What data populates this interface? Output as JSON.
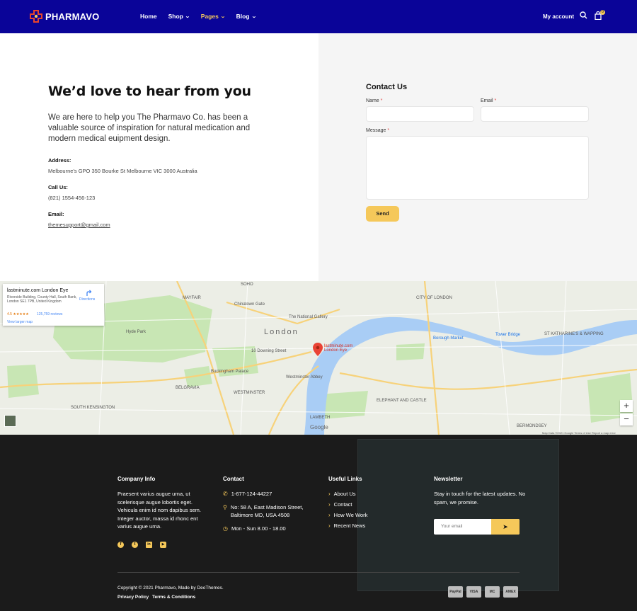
{
  "header": {
    "brand": "PHARMAVO",
    "nav": [
      {
        "label": "Home",
        "dropdown": false,
        "active": false
      },
      {
        "label": "Shop",
        "dropdown": true,
        "active": false
      },
      {
        "label": "Pages",
        "dropdown": true,
        "active": true
      },
      {
        "label": "Blog",
        "dropdown": true,
        "active": false
      }
    ],
    "account_label": "My account",
    "cart_count": "0",
    "icons": [
      "search-icon",
      "cart-icon"
    ],
    "colors": {
      "background": "#0a0498",
      "accent": "#f4c95d"
    }
  },
  "intro": {
    "heading": "We’d love to hear from you",
    "description": "We are here to help you The Pharmavo Co. has been a valuable source of inspiration for natural medication and modern medical euipment design.",
    "address_label": "Address:",
    "address_value": "Melbourne's GPO 350 Bourke St Melbourne VIC 3000 Australia",
    "call_label": "Call Us:",
    "call_value": "(821) 1554-456-123",
    "email_label": "Email:",
    "email_value": "themesupport@gmail.com"
  },
  "contact_form": {
    "title": "Contact Us",
    "name_label": "Name",
    "email_label": "Email",
    "message_label": "Message",
    "required_mark": "*",
    "name_value": "",
    "email_value": "",
    "message_value": "",
    "send_label": "Send"
  },
  "map": {
    "card": {
      "title": "lastminute.com London Eye",
      "address": "Riverside Building, County Hall, South Bank, London SE1 7PB, United Kingdom",
      "rating": "4.5 ★★★★★",
      "reviews": "125,759 reviews",
      "directions": "Directions",
      "view_larger": "View larger map"
    },
    "labels": {
      "london": "London",
      "city_of_london": "CITY OF LONDON",
      "mayfair": "MAYFAIR",
      "westminster": "WESTMINSTER",
      "belgravia": "BELGRAVIA",
      "lambeth": "LAMBETH",
      "south_kensington": "SOUTH KENSINGTON",
      "soho": "SOHO",
      "hyde_park": "Hyde Park",
      "chinatown": "Chinatown Gate",
      "national_gallery": "The National Gallery",
      "buckingham": "Buckingham Palace",
      "downing": "10 Downing Street",
      "abbey": "Westminster Abbey",
      "tower_bridge": "Tower Bridge",
      "borough": "Borough Market",
      "elephant": "ELEPHANT AND CASTLE",
      "bermondsey": "BERMONDSEY",
      "pin_label": "lastminute.com London Eye",
      "st_katharine": "ST KATHARINE'S & WAPPING",
      "google": "Google",
      "footer_note": "Map Data ©2021 Google   Terms of Use   Report a map error"
    },
    "zoom_in": "+",
    "zoom_out": "−"
  },
  "footer": {
    "company_title": "Company Info",
    "company_text": "Praesent varius augue urna, ut scelerisque augue lobortis eget. Vehicula enim id nom dapibus sem. Integer auctor, massa id rhonc ent varius augue urna.",
    "contact_title": "Contact",
    "phone": "1-677-124-44227",
    "address": "No: 58 A, East Madison Street, Baltimore MD, USA 4508",
    "hours": "Mon - Sun 8.00 - 18.00",
    "links_title": "Useful Links",
    "links": [
      "About Us",
      "Contact",
      "How We Work",
      "Recent News"
    ],
    "newsletter_title": "Newsletter",
    "newsletter_text": "Stay in touch for the latest updates. No spam, we promise.",
    "newsletter_placeholder": "Your email",
    "copyright": "Copyright © 2021 Pharmavo, Made by DeoThemes.",
    "privacy": "Privacy Policy",
    "terms": "Terms & Conditions",
    "payments": [
      "PayPal",
      "VISA",
      "MC",
      "AMEX"
    ],
    "social": [
      "facebook-icon",
      "twitter-icon",
      "linkedin-icon",
      "youtube-icon"
    ]
  }
}
